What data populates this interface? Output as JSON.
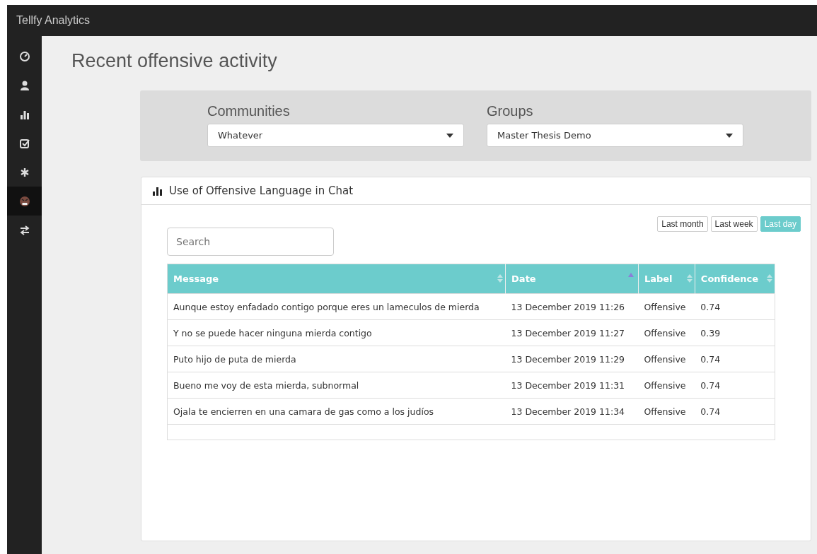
{
  "app_title": "Tellfy Analytics",
  "sidebar": {
    "items": [
      {
        "selected": false
      },
      {
        "selected": false
      },
      {
        "selected": false
      },
      {
        "selected": false
      },
      {
        "selected": false
      },
      {
        "selected": true
      },
      {
        "selected": false
      }
    ]
  },
  "page_title": "Recent offensive activity",
  "filters": [
    {
      "label": "Communities",
      "value": "Whatever"
    },
    {
      "label": "Groups",
      "value": "Master Thesis Demo"
    }
  ],
  "card": {
    "title": "Use of Offensive Language in Chat",
    "ranges": [
      {
        "label": "Last month",
        "selected": false
      },
      {
        "label": "Last week",
        "selected": false
      },
      {
        "label": "Last day",
        "selected": true
      }
    ],
    "search": {
      "placeholder": "Search"
    },
    "table": {
      "columns": [
        {
          "label": "Message",
          "sorted": false
        },
        {
          "label": "Date",
          "sorted": true
        },
        {
          "label": "Label",
          "sorted": false
        },
        {
          "label": "Confidence",
          "sorted": false
        }
      ],
      "rows": [
        [
          "Aunque estoy enfadado contigo porque eres un lameculos de mierda",
          "13 December 2019 11:26",
          "Offensive",
          "0.74"
        ],
        [
          "Y no se puede hacer ninguna mierda contigo",
          "13 December 2019 11:27",
          "Offensive",
          "0.39"
        ],
        [
          "Puto hijo de puta de mierda",
          "13 December 2019 11:29",
          "Offensive",
          "0.74"
        ],
        [
          "Bueno me voy de esta mierda, subnormal",
          "13 December 2019 11:31",
          "Offensive",
          "0.74"
        ],
        [
          "Ojala te encierren en una camara de gas como a los judíos",
          "13 December 2019 11:34",
          "Offensive",
          "0.74"
        ]
      ]
    }
  }
}
